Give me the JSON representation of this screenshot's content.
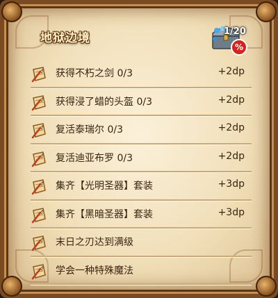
{
  "panel": {
    "title": "地狱边境",
    "chest_counter": "1/20",
    "percent_badge": "%"
  },
  "quests": [
    {
      "label": "获得不朽之剑 0/3",
      "reward": "+2dp"
    },
    {
      "label": "获得浸了蜡的头盔 0/3",
      "reward": "+2dp"
    },
    {
      "label": "复活泰瑞尔 0/3",
      "reward": "+2dp"
    },
    {
      "label": "复活迪亚布罗 0/3",
      "reward": "+2dp"
    },
    {
      "label": "集齐【光明圣器】套装",
      "reward": "+3dp"
    },
    {
      "label": "集齐【黑暗圣器】套装",
      "reward": "+3dp"
    },
    {
      "label": "末日之刃达到满级",
      "reward": ""
    },
    {
      "label": "学会一种特殊魔法",
      "reward": ""
    }
  ],
  "icons": {
    "quest_item": "scroll-quill-icon",
    "chest": "treasure-chest-icon"
  },
  "colors": {
    "frame": "#7a4a22",
    "parchment": "#f1dfb9",
    "text": "#3a2412",
    "badge": "#d8231c"
  }
}
